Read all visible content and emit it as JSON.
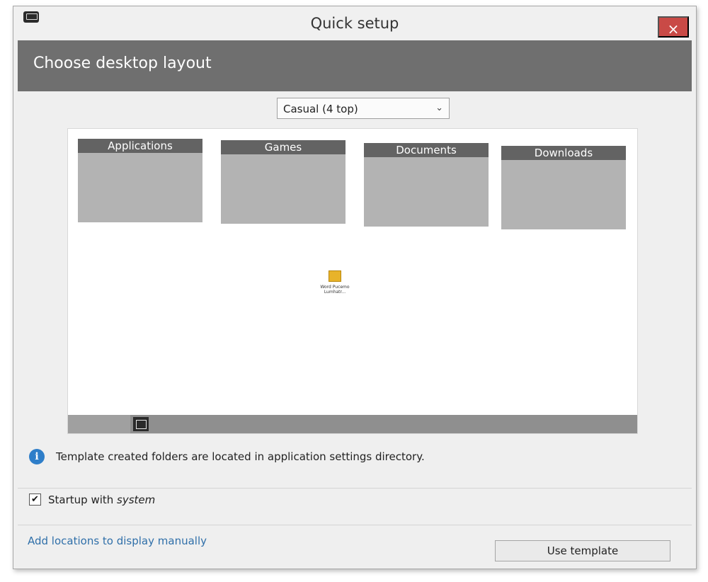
{
  "window": {
    "title": "Quick setup",
    "close_symbol": "×",
    "app_icon": "app-monitor-icon"
  },
  "header": {
    "title": "Choose desktop layout"
  },
  "layout_select": {
    "selected": "Casual (4 top)",
    "arrow": "⌄"
  },
  "preview": {
    "fences": [
      {
        "label": "Applications"
      },
      {
        "label": "Games"
      },
      {
        "label": "Documents"
      },
      {
        "label": "Downloads"
      }
    ],
    "desktop_icon": {
      "label": "Word Pucemo Lumhatr..."
    }
  },
  "info": {
    "text": "Template created folders are located in application settings directory."
  },
  "startup": {
    "checked": true,
    "check_mark": "✔",
    "label_prefix": "Startup with ",
    "label_emphasis": "system"
  },
  "footer": {
    "manual_link": "Add locations to display manually",
    "use_template_label": "Use template"
  },
  "colors": {
    "close_red": "#c94a46",
    "header_gray": "#6f6f6f",
    "link_blue": "#2f6fa9",
    "info_blue": "#2e7ec9"
  }
}
